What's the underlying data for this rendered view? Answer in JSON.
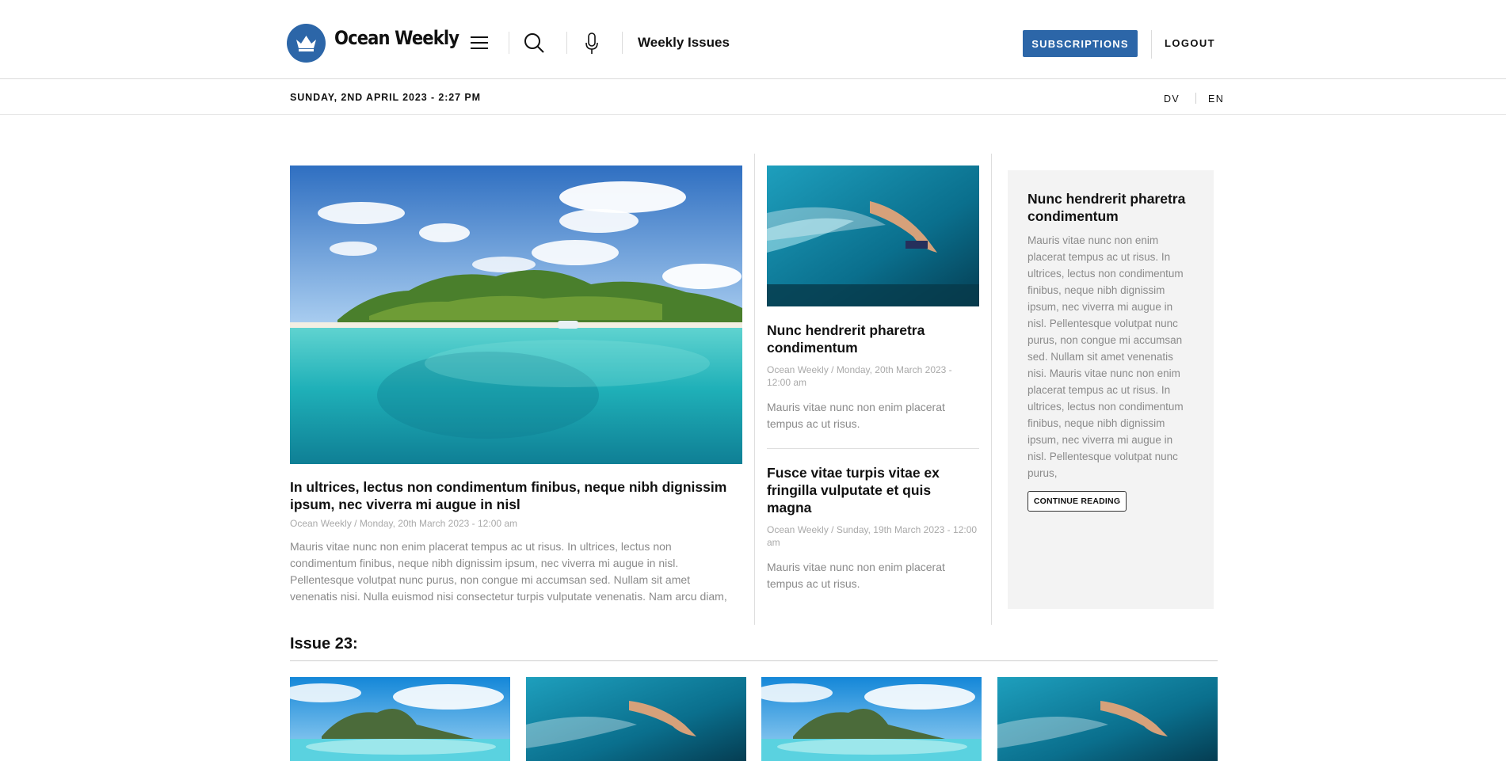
{
  "header": {
    "logo_text": "Ocean Weekly",
    "weekly_issues": "Weekly Issues",
    "subscriptions_label": "SUBSCRIPTIONS",
    "logout_label": "LOGOUT",
    "brand_color": "#2c66a8",
    "icons": [
      "crown-icon",
      "menu-icon",
      "search-icon",
      "microphone-icon"
    ]
  },
  "datebar": {
    "date": "SUNDAY, 2ND APRIL 2023 - 2:27 PM",
    "languages": [
      "DV",
      "EN"
    ]
  },
  "featured": {
    "title_lines": [
      "In ultrices, lectus non condimentum finibus, neque nibh dignissim",
      "ipsum, nec viverra mi augue in nisl"
    ],
    "meta": "Ocean Weekly / Monday, 20th March 2023 - 12:00 am",
    "excerpt_lines": [
      "Mauris vitae nunc non enim placerat tempus ac ut risus. In ultrices, lectus non",
      "condimentum finibus, neque nibh dignissim ipsum, nec viverra mi augue in nisl.",
      "Pellentesque volutpat nunc purus, non congue mi accumsan sed. Nullam sit amet",
      "venenatis nisi. Nulla euismod nisi consectetur turpis vulputate venenatis. Nam arcu diam,"
    ]
  },
  "middle": {
    "articles": [
      {
        "title_lines": [
          "Nunc hendrerit pharetra",
          "condimentum"
        ],
        "meta_lines": [
          "Ocean Weekly / Monday, 20th March 2023 -",
          "12:00 am"
        ],
        "excerpt_lines": [
          "Mauris vitae nunc non enim placerat",
          "tempus ac ut risus."
        ]
      },
      {
        "title_lines": [
          "Fusce vitae turpis vitae ex",
          "fringilla vulputate et quis",
          "magna"
        ],
        "meta_lines": [
          "Ocean Weekly / Sunday, 19th March 2023 - 12:00",
          "am"
        ],
        "excerpt_lines": [
          "Mauris vitae nunc non enim placerat",
          "tempus ac ut risus."
        ]
      }
    ]
  },
  "aside": {
    "title_lines": [
      "Nunc hendrerit pharetra",
      "condimentum"
    ],
    "body_lines": [
      "Mauris vitae nunc non enim",
      "placerat tempus ac ut risus. In",
      "ultrices, lectus non condimentum",
      "finibus, neque nibh dignissim",
      "ipsum, nec viverra mi augue in",
      "nisl. Pellentesque volutpat nunc",
      "purus, non congue mi accumsan",
      "sed. Nullam sit amet venenatis",
      "nisi. Mauris vitae nunc non enim",
      "placerat tempus ac ut risus. In",
      "ultrices, lectus non condimentum",
      "finibus, neque nibh dignissim",
      "ipsum, nec viverra mi augue in",
      "nisl. Pellentesque volutpat nunc",
      "purus,"
    ],
    "continue_label": "CONTINUE READING"
  },
  "issue": {
    "title": "Issue 23:"
  }
}
